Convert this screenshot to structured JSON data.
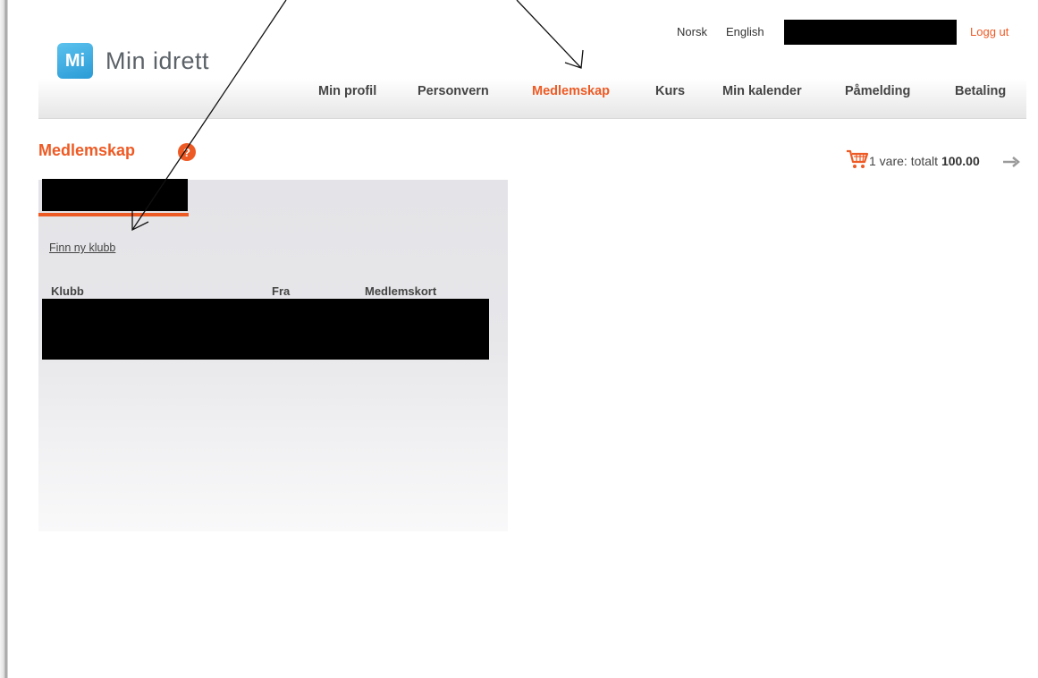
{
  "brand": {
    "badge": "Mi",
    "name": "Min idrett"
  },
  "top_links": {
    "norsk": "Norsk",
    "english": "English",
    "logout": "Logg ut"
  },
  "nav": [
    {
      "label": "Min profil"
    },
    {
      "label": "Personvern"
    },
    {
      "label": "Medlemskap",
      "active": true
    },
    {
      "label": "Kurs"
    },
    {
      "label": "Min kalender"
    },
    {
      "label": "Påmelding"
    },
    {
      "label": "Betaling"
    }
  ],
  "page": {
    "title": "Medlemskap",
    "help_icon": "?"
  },
  "cart": {
    "summary": "1 vare: totalt ",
    "total": "100.00",
    "icon": "cart-icon",
    "arrow": "arrow-right-icon"
  },
  "membership": {
    "find_club_link": "Finn ny klubb",
    "columns": [
      "Klubb",
      "Fra",
      "Medlemskort"
    ]
  },
  "colors": {
    "accent": "#ee5a24",
    "logo_blue": "#2a9bd6",
    "text": "#444444",
    "redaction": "#000000"
  }
}
